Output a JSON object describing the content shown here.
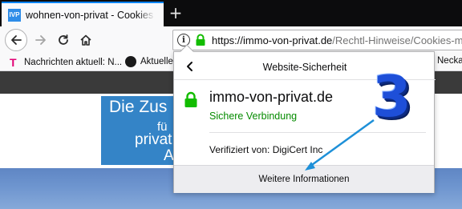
{
  "browser": {
    "tab": {
      "favicon": "IVP",
      "title": "wohnen-von-privat - Cookies n"
    },
    "new_tab_icon": "plus-icon",
    "url": {
      "host": "https://immo-von-privat.de",
      "path": "/Rechtl-Hinweise/Cookies-me"
    },
    "bookmarks": [
      {
        "label": "Nachrichten aktuell: N...",
        "icon": "telekom-logo"
      },
      {
        "label": "Aktuelle",
        "icon": "news-logo"
      },
      {
        "label": "Necka.",
        "icon": "none"
      }
    ],
    "accent_color": "#0a84ff"
  },
  "popup": {
    "title": "Website-Sicherheit",
    "domain": "immo-von-privat.de",
    "status": "Sichere Verbindung",
    "status_color": "#058b00",
    "verified": "Verifiziert von: DigiCert Inc",
    "more_info": "Weitere Informationen"
  },
  "website": {
    "banner_lines": [
      "Die Zus",
      "fü",
      "privat",
      "A"
    ]
  },
  "annotation": {
    "step_number": "3",
    "color": "#1e4fd8",
    "arrow_color": "#1e90d8"
  }
}
